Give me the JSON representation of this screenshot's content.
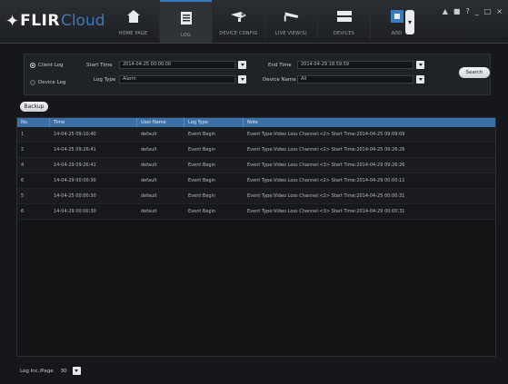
{
  "logo": {
    "mark": "✦",
    "brand": "FLIR",
    "cloud": "Cloud"
  },
  "nav": [
    {
      "label": "HOME PAGE",
      "icon": "home-icon"
    },
    {
      "label": "LOG",
      "icon": "log-icon",
      "active": true
    },
    {
      "label": "DEVICE CONFIG",
      "icon": "device-config-icon"
    },
    {
      "label": "LIVE VIEW(S)",
      "icon": "camera-icon"
    },
    {
      "label": "DEVICES",
      "icon": "devices-icon"
    },
    {
      "label": "ADD",
      "icon": "add-icon"
    }
  ],
  "window_controls": [
    "▲",
    "■",
    "?",
    "_",
    "□",
    "×"
  ],
  "filter": {
    "client_log_label": "Client Log",
    "device_log_label": "Device Log",
    "start_time_label": "Start Time",
    "start_time_value": "2014-04-25 00:00:00",
    "end_time_label": "End Time",
    "end_time_value": "2014-04-29 18:59:59",
    "log_type_label": "Log Type",
    "log_type_value": "Alarm",
    "device_name_label": "Device Name",
    "device_name_value": "All",
    "search_label": "Search"
  },
  "backup_label": "Backup",
  "table": {
    "headers": [
      "No.",
      "Time",
      "User Name",
      "Log Type",
      "Note"
    ],
    "rows": [
      [
        "1",
        "14-04-25 09:10:40",
        "default",
        "Event Begin",
        "Event Type:Video Loss Channel:<2> Start Time:2014-04-25 09:09:09"
      ],
      [
        "2",
        "14-04-25 09:26:41",
        "default",
        "Event Begin",
        "Event Type:Video Loss Channel:<2> Start Time:2014-04-25 09:26:26"
      ],
      [
        "4",
        "14-04-29 09:26:41",
        "default",
        "Event Begin",
        "Event Type:Video Loss Channel:<3> Start Time:2014-04-29 09:26:26"
      ],
      [
        "6",
        "14-04-29 00:00:30",
        "default",
        "Event Begin",
        "Event Type:Video Loss Channel:<2> Start Time:2014-04-29 00:00:11"
      ],
      [
        "5",
        "14-04-25 00:00:30",
        "default",
        "Event Begin",
        "Event Type:Video Loss Channel:<2> Start Time:2014-04-25 00:00:31"
      ],
      [
        "6",
        "14-04-29 00:00:30",
        "default",
        "Event Begin",
        "Event Type:Video Loss Channel:<3> Start Time:2014-04-29 00:00:31"
      ]
    ]
  },
  "footer": {
    "label": "Log Inc./Page",
    "value": "30"
  },
  "colors": {
    "accent": "#3a6fa8",
    "background": "#15171a",
    "panel": "#1f2226"
  }
}
